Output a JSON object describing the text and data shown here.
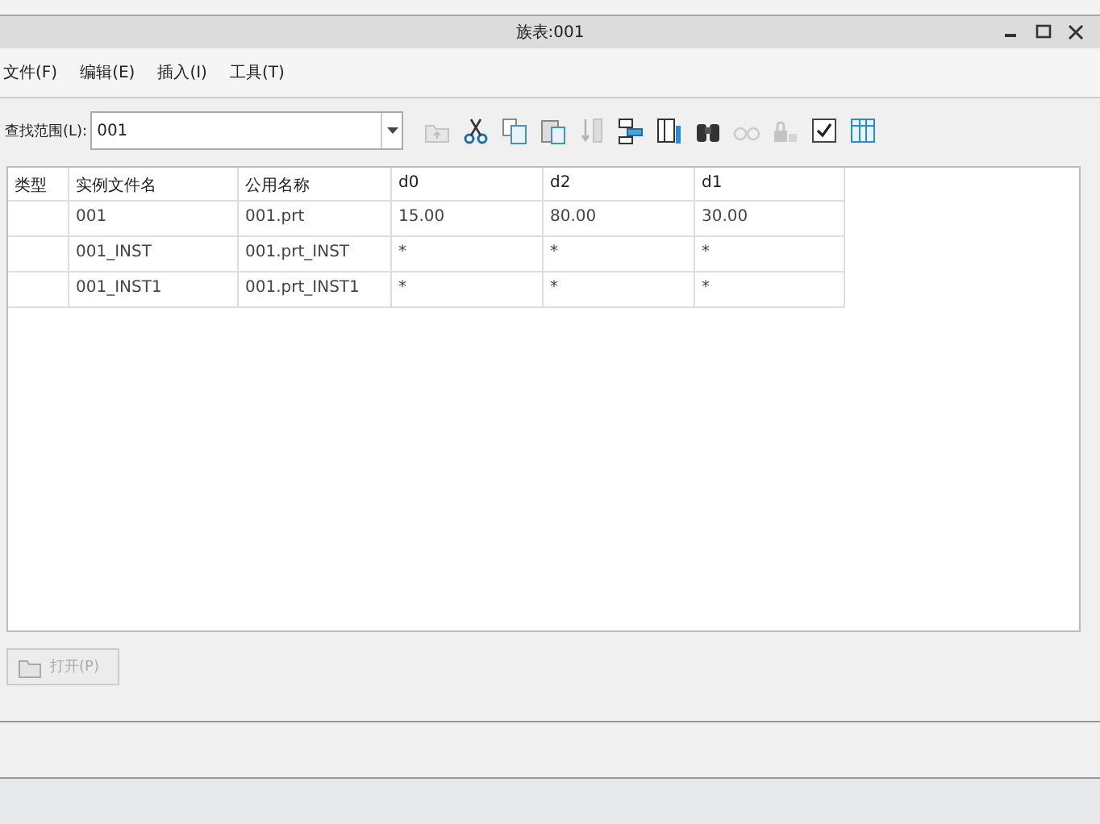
{
  "window": {
    "title": "族表:001"
  },
  "menu": [
    "文件(F)",
    "编辑(E)",
    "插入(I)",
    "工具(T)"
  ],
  "find": {
    "label": "查找范围(L):",
    "value": "001"
  },
  "tools": [
    {
      "kind": "up-folder",
      "disabled": true
    },
    {
      "kind": "cut",
      "disabled": false
    },
    {
      "kind": "copy",
      "disabled": false
    },
    {
      "kind": "paste",
      "disabled": false
    },
    {
      "kind": "sort",
      "disabled": true
    },
    {
      "kind": "structure",
      "disabled": false
    },
    {
      "kind": "insert-column",
      "disabled": false
    },
    {
      "kind": "binoculars",
      "disabled": false
    },
    {
      "kind": "glasses",
      "disabled": true
    },
    {
      "kind": "lock",
      "disabled": true
    },
    {
      "kind": "checkbox",
      "disabled": false
    },
    {
      "kind": "table",
      "disabled": false
    }
  ],
  "table": {
    "columns": [
      "类型",
      "实例文件名",
      "公用名称",
      "d0",
      "d2",
      "d1"
    ],
    "rows": [
      [
        "",
        "001",
        "001.prt",
        "15.00",
        "80.00",
        "30.00"
      ],
      [
        "",
        "001_INST",
        "001.prt_INST",
        "*",
        "*",
        "*"
      ],
      [
        "",
        "001_INST1",
        "001.prt_INST1",
        "*",
        "*",
        "*"
      ]
    ]
  },
  "open_button": {
    "label": "打开(P)",
    "disabled": true
  }
}
